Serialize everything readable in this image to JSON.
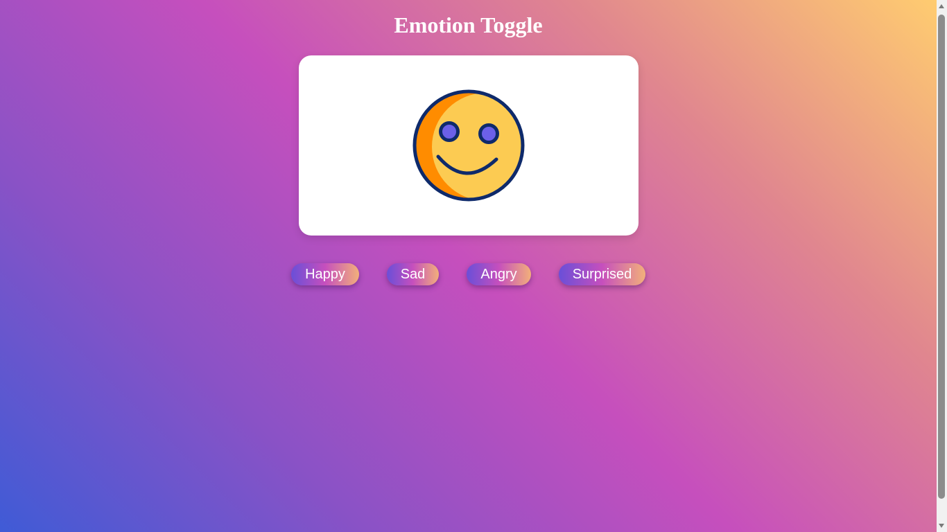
{
  "page": {
    "title": "Emotion Toggle"
  },
  "display": {
    "current_emotion": "happy",
    "face_colors": {
      "outline": "#0e2a6b",
      "face_fill": "#fccb52",
      "face_shadow": "#ff8c00",
      "eye_fill": "#6b60e8"
    }
  },
  "buttons": {
    "happy": "Happy",
    "sad": "Sad",
    "angry": "Angry",
    "surprised": "Surprised"
  },
  "colors": {
    "background_gradient": [
      "#3f5bd6",
      "#8a52c6",
      "#c64fbd",
      "#e0868f",
      "#ffcc70"
    ],
    "button_gradient": [
      "#6a4fd8",
      "#c64fbd",
      "#f2b07a"
    ],
    "card": "#ffffff"
  }
}
